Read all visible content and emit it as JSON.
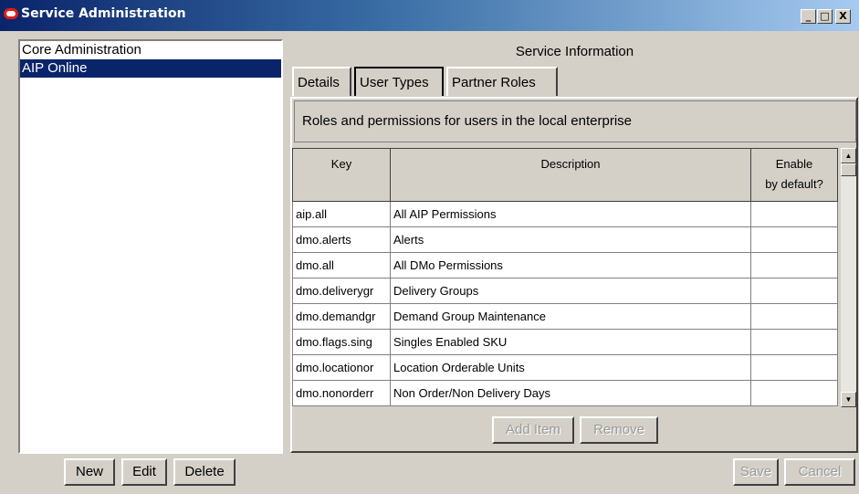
{
  "window": {
    "title": "Service Administration",
    "buttons": {
      "minimize": "_",
      "maximize": "□",
      "close": "X"
    }
  },
  "sidebar": {
    "items": [
      {
        "label": "Core Administration",
        "selected": false
      },
      {
        "label": "AIP Online",
        "selected": true
      }
    ]
  },
  "sidebar_actions": {
    "new": "New",
    "edit": "Edit",
    "delete": "Delete"
  },
  "main": {
    "title": "Service Information",
    "tabs": [
      {
        "label": "Details"
      },
      {
        "label": "User Types",
        "active": true
      },
      {
        "label": "Partner Roles"
      }
    ],
    "description": "Roles and permissions for users in the local enterprise",
    "table": {
      "columns": [
        "Key",
        "Description",
        "Enable",
        "by default?"
      ],
      "rows": [
        {
          "key": "aip.all",
          "description": "All AIP Permissions"
        },
        {
          "key": "dmo.alerts",
          "description": "Alerts"
        },
        {
          "key": "dmo.all",
          "description": "All DMo Permissions"
        },
        {
          "key": "dmo.deliverygr",
          "description": "Delivery Groups"
        },
        {
          "key": "dmo.demandgr",
          "description": "Demand Group Maintenance"
        },
        {
          "key": "dmo.flags.sing",
          "description": "Singles Enabled SKU"
        },
        {
          "key": "dmo.locationor",
          "description": "Location Orderable Units"
        },
        {
          "key": "dmo.nonorderr",
          "description": "Non Order/Non Delivery Days"
        }
      ]
    },
    "table_actions": {
      "add_item": "Add Item",
      "remove": "Remove"
    }
  },
  "footer_actions": {
    "save": "Save",
    "cancel": "Cancel"
  },
  "colors": {
    "selection": "#0a246a",
    "window_bg": "#d4d0c8",
    "logo": "#e21b1b"
  }
}
